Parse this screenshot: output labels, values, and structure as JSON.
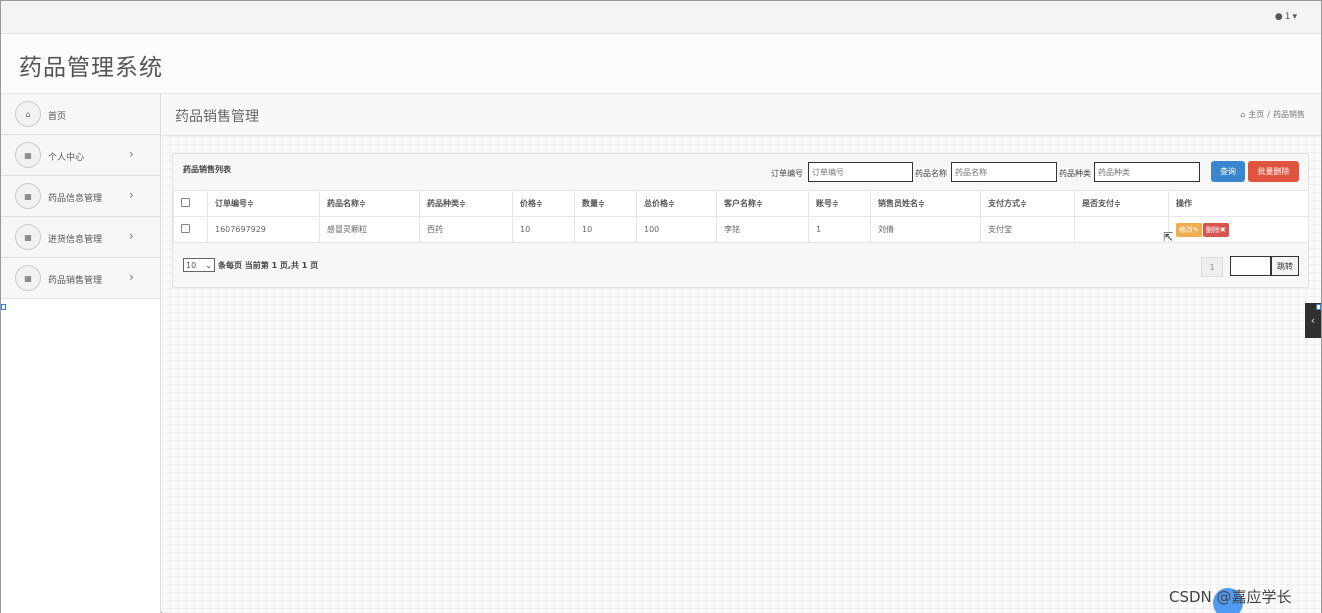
{
  "topbar": {
    "user_label": "1"
  },
  "app": {
    "title": "药品管理系统"
  },
  "sidebar": {
    "items": [
      {
        "label": "首页",
        "has_chevron": false
      },
      {
        "label": "个人中心",
        "has_chevron": true
      },
      {
        "label": "药品信息管理",
        "has_chevron": true
      },
      {
        "label": "进货信息管理",
        "has_chevron": true
      },
      {
        "label": "药品销售管理",
        "has_chevron": true
      }
    ]
  },
  "page": {
    "title": "药品销售管理",
    "breadcrumb": {
      "home": "主页",
      "separator": "/",
      "current": "药品销售"
    }
  },
  "panel": {
    "title": "药品销售列表",
    "filters": [
      {
        "label": "订单编号",
        "placeholder": "订单编号"
      },
      {
        "label": "药品名称",
        "placeholder": "药品名称"
      },
      {
        "label": "药品种类",
        "placeholder": "药品种类"
      }
    ],
    "search_button": "查询",
    "batch_delete_button": "批量删除"
  },
  "table": {
    "columns": [
      "订单编号",
      "药品名称",
      "药品种类",
      "价格",
      "数量",
      "总价格",
      "客户名称",
      "账号",
      "销售员姓名",
      "支付方式",
      "是否支付",
      "操作"
    ],
    "sort_marker": "≑",
    "rows": [
      [
        "1607697929",
        "感冒灵颗粒",
        "西药",
        "10",
        "10",
        "100",
        "李铭",
        "1",
        "刘倩",
        "支付宝",
        ""
      ]
    ],
    "edit_label": "修改",
    "delete_label": "删除"
  },
  "pagination": {
    "page_size": "10",
    "info_text": "条每页 当前第 1 页,共 1 页",
    "current_page": "1",
    "jump_label": "跳转"
  },
  "watermark": "CSDN @嘉应学长",
  "colors": {
    "primary": "#3a87cf",
    "danger": "#e0543f",
    "warning": "#f0ad4e"
  }
}
